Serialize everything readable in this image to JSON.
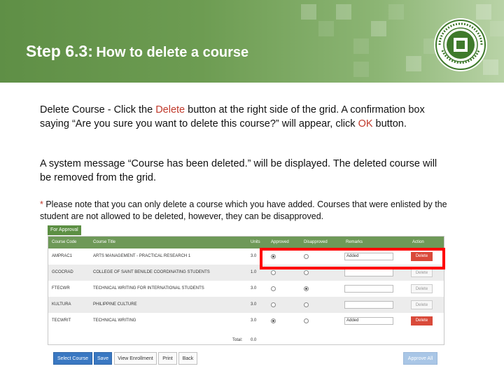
{
  "slide": {
    "title_step": "Step 6.3:",
    "title_rest": "How to delete a course"
  },
  "paragraph1": {
    "lead": "Delete Course",
    "t1": " - Click the ",
    "delete_word": "Delete",
    "t2": " button at the right side of the grid. A confirmation box saying “Are you sure you want to delete this course?” will appear, click ",
    "ok_word": "OK",
    "t3": " button."
  },
  "paragraph2": "A system message “Course has been deleted.” will be displayed.  The deleted course will be removed from the grid.",
  "paragraph3": {
    "asterisk": "*",
    "text": " Please note that you can only delete a course which you have added.  Courses that were enlisted by the student are not allowed to be deleted,  however, they can be disapproved."
  },
  "grid": {
    "tab": "For Approval",
    "headers": {
      "code": "Course Code",
      "title": "Course Title",
      "units": "Units",
      "approved": "Approved",
      "disapproved": "Disapproved",
      "remarks": "Remarks",
      "action": "Action"
    },
    "rows": [
      {
        "code": "AMPRAC1",
        "title": "ARTS MANAGEMENT - PRACTICAL RESEARCH 1",
        "units": "3.0",
        "approved": true,
        "disapproved": false,
        "remarks": "Added",
        "action": "Delete",
        "active": true
      },
      {
        "code": "GCOCRAD",
        "title": "COLLEGE OF SAINT BENILDE COORDINATING STUDENTS",
        "units": "1.0",
        "approved": false,
        "disapproved": false,
        "remarks": "",
        "action": "Delete",
        "active": false
      },
      {
        "code": "FTECWR",
        "title": "TECHNICAL WRITING FOR INTERNATIONAL STUDENTS",
        "units": "3.0",
        "approved": false,
        "disapproved": true,
        "remarks": "",
        "action": "Delete",
        "active": false
      },
      {
        "code": "KULTURA",
        "title": "PHILIPPINE CULTURE",
        "units": "3.0",
        "approved": false,
        "disapproved": false,
        "remarks": "",
        "action": "Delete",
        "active": false
      },
      {
        "code": "TECWRIT",
        "title": "TECHNICAL WRITING",
        "units": "3.0",
        "approved": true,
        "disapproved": false,
        "remarks": "Added",
        "action": "Delete",
        "active": true
      }
    ],
    "total_label": "Total:",
    "total_value": "0.0"
  },
  "buttons": {
    "select_course": "Select Course",
    "save": "Save",
    "view_enrollment": "View Enrollment",
    "print": "Print",
    "back": "Back",
    "approve_all": "Approve All"
  },
  "colors": {
    "banner_green": "#6d9c52",
    "grid_header": "#6e9958",
    "delete_red": "#d94a3a",
    "highlight": "#ff0000",
    "button_blue": "#3a78c2"
  }
}
